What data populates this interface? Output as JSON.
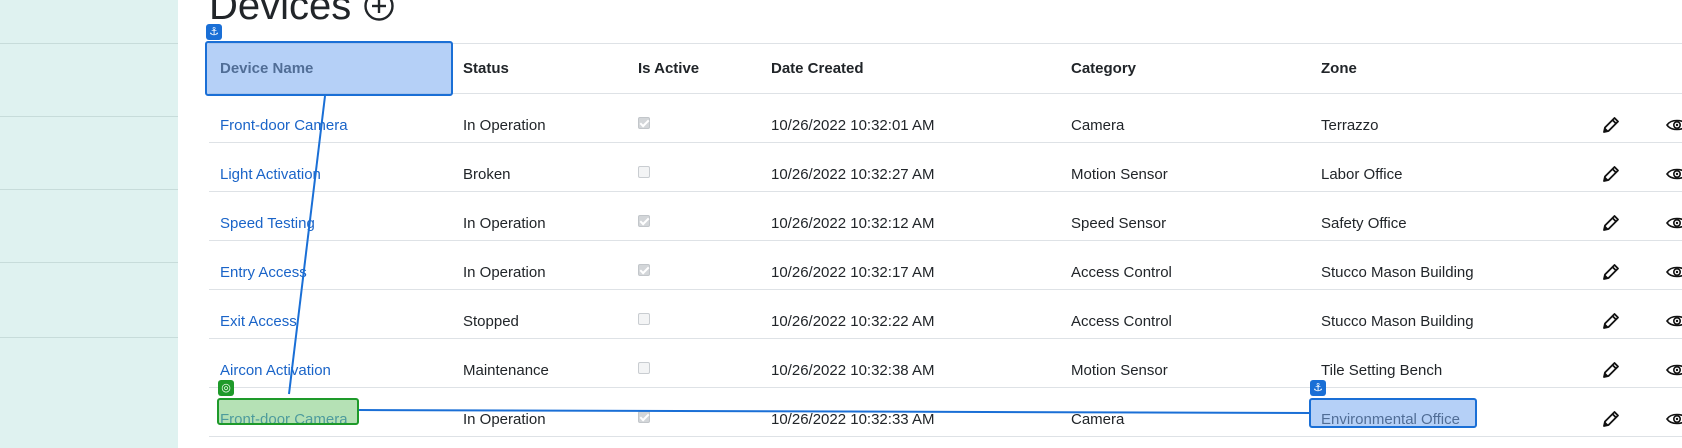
{
  "page": {
    "title": "Devices",
    "add_icon": "plus-circle-icon"
  },
  "table": {
    "columns": [
      "Device Name",
      "Status",
      "Is Active",
      "Date Created",
      "Category",
      "Zone"
    ],
    "rows": [
      {
        "name": "Front-door Camera",
        "status": "In Operation",
        "active": true,
        "date": "10/26/2022 10:32:01 AM",
        "category": "Camera",
        "zone": "Terrazzo"
      },
      {
        "name": "Light Activation",
        "status": "Broken",
        "active": false,
        "date": "10/26/2022 10:32:27 AM",
        "category": "Motion Sensor",
        "zone": "Labor Office"
      },
      {
        "name": "Speed Testing",
        "status": "In Operation",
        "active": true,
        "date": "10/26/2022 10:32:12 AM",
        "category": "Speed Sensor",
        "zone": "Safety Office"
      },
      {
        "name": "Entry Access",
        "status": "In Operation",
        "active": true,
        "date": "10/26/2022 10:32:17 AM",
        "category": "Access Control",
        "zone": "Stucco Mason Building"
      },
      {
        "name": "Exit Access",
        "status": "Stopped",
        "active": false,
        "date": "10/26/2022 10:32:22 AM",
        "category": "Access Control",
        "zone": "Stucco Mason Building"
      },
      {
        "name": "Aircon Activation",
        "status": "Maintenance",
        "active": false,
        "date": "10/26/2022 10:32:38 AM",
        "category": "Motion Sensor",
        "zone": "Tile Setting Bench"
      },
      {
        "name": "Front-door Camera",
        "status": "In Operation",
        "active": true,
        "date": "10/26/2022 10:32:33 AM",
        "category": "Camera",
        "zone": "Environmental Office"
      }
    ],
    "row_action_icons": [
      "pencil-edit-icon",
      "eye-view-icon"
    ]
  },
  "annotations": {
    "colors": {
      "blue": "#1a6fd6",
      "green": "#1e9a2a"
    },
    "anchor_icon": "anchor-icon",
    "target_icon": "target-icon"
  }
}
